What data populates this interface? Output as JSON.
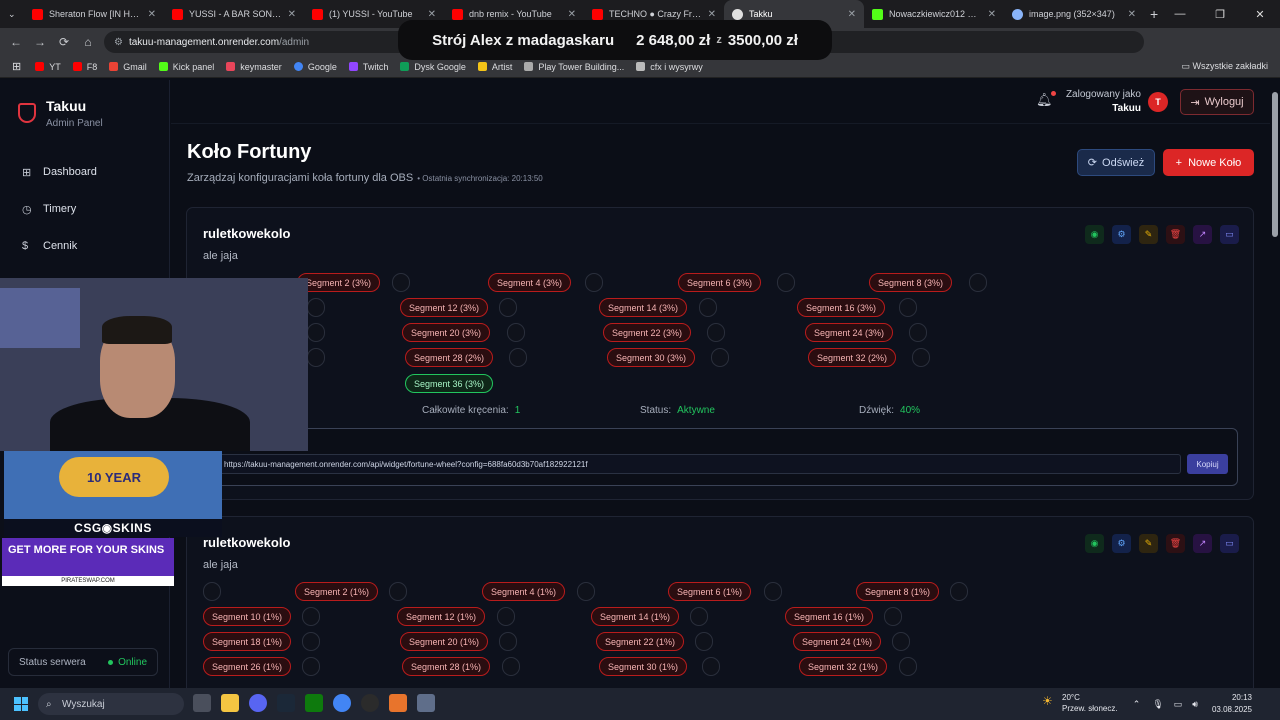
{
  "tabs": [
    {
      "title": "Sheraton Flow [IN HAJS W",
      "color": "#ff0000"
    },
    {
      "title": "YUSSI - A BAR SONG (TIP",
      "color": "#ff0000"
    },
    {
      "title": "(1) YUSSI - YouTube",
      "color": "#ff0000"
    },
    {
      "title": "dnb remix - YouTube",
      "color": "#ff0000"
    },
    {
      "title": "TECHNO ● Crazy Frog - A",
      "color": "#ff0000"
    },
    {
      "title": "Takku",
      "color": "#e0e0e0"
    },
    {
      "title": "Nowaczkiewicz012 Stream",
      "color": "#53fc18"
    },
    {
      "title": "image.png (352×347)",
      "color": "#8ab4f8"
    }
  ],
  "address": {
    "host": "takuu-management.onrender.com",
    "path": "/admin"
  },
  "donation": {
    "label": "Strój Alex z madagaskaru",
    "current": "2 648,00 zł",
    "separator": "z",
    "goal": "3500,00 zł"
  },
  "bookmarks": [
    {
      "label": "YT",
      "color": "#ff0000"
    },
    {
      "label": "F8",
      "color": "#ff0000"
    },
    {
      "label": "Gmail",
      "color": "#ea4335"
    },
    {
      "label": "Kick panel",
      "color": "#53fc18"
    },
    {
      "label": "keymaster",
      "color": "#e8455a"
    },
    {
      "label": "Google",
      "color": "#4285f4"
    },
    {
      "label": "Twitch",
      "color": "#9146ff"
    },
    {
      "label": "Dysk Google",
      "color": "#0f9d58"
    },
    {
      "label": "Artist",
      "color": "#f5c518"
    },
    {
      "label": "Play Tower Building...",
      "color": "#aaaaaa"
    },
    {
      "label": "cfx i wysyrwy",
      "color": "#bbbbbb"
    }
  ],
  "all_bookmarks": "Wszystkie zakładki",
  "sidebar": {
    "brand": "Takuu",
    "subtitle": "Admin Panel",
    "items": [
      {
        "label": "Dashboard",
        "icon": "grid-icon"
      },
      {
        "label": "Timery",
        "icon": "timer-icon"
      },
      {
        "label": "Cennik",
        "icon": "dollar-icon"
      }
    ],
    "server_status_label": "Status serwera",
    "server_status_value": "Online"
  },
  "header": {
    "logged_as": "Zalogowany jako",
    "user": "Takuu",
    "avatar_letter": "T",
    "logout": "Wyloguj"
  },
  "page": {
    "title": "Koło Fortuny",
    "subtitle": "Zarządzaj konfiguracjami koła fortuny dla OBS",
    "sync": "• Ostatnia synchronizacja: 20:13:50",
    "refresh": "Odśwież",
    "new_wheel": "Nowe Koło"
  },
  "wheels": [
    {
      "name": "ruletkowekolo",
      "description": "ale jaja",
      "segments_visible": [
        "Segment 2 (3%)",
        "Segment 4 (3%)",
        "Segment 6 (3%)",
        "Segment 8 (3%)",
        "Segment 12 (3%)",
        "Segment 14 (3%)",
        "Segment 16 (3%)",
        "Segment 20 (3%)",
        "Segment 22 (3%)",
        "Segment 24 (3%)",
        "Segment 28 (2%)",
        "Segment 30 (3%)",
        "Segment 32 (2%)",
        "Segment 36 (3%)"
      ],
      "stats": {
        "spins_label": "Całkowite kręcenia:",
        "spins": "1",
        "status_label": "Status:",
        "status": "Aktywne",
        "sound_label": "Dźwięk:",
        "sound": "40%"
      },
      "widget_url": "https://takuu-management.onrender.com/api/widget/fortune-wheel?config=688fa60d3b70af182922121f",
      "copy_label": "Kopiuj"
    },
    {
      "name": "ruletkowekolo",
      "description": "ale jaja",
      "segments_visible": [
        "Segment 2 (1%)",
        "Segment 4 (1%)",
        "Segment 6 (1%)",
        "Segment 8 (1%)",
        "Segment 10 (1%)",
        "Segment 12 (1%)",
        "Segment 14 (1%)",
        "Segment 16 (1%)",
        "Segment 18 (1%)",
        "Segment 20 (1%)",
        "Segment 22 (1%)",
        "Segment 24 (1%)",
        "Segment 26 (1%)",
        "Segment 28 (1%)",
        "Segment 30 (1%)",
        "Segment 32 (1%)"
      ]
    }
  ],
  "overlay": {
    "anniversary": "10 YEAR",
    "brand": "CSG◉SKINS",
    "promo_text": "GET MORE FOR YOUR SKINS",
    "promo_site": "PIRATESWAP.COM"
  },
  "taskbar": {
    "search": "Wyszukaj",
    "temp": "20°C",
    "weather": "Przew. słonecz.",
    "time": "20:13",
    "date": "03.08.2025"
  },
  "colors": {
    "accent": "#dc2626",
    "green": "#22c55e",
    "blue": "#3b82f6"
  }
}
